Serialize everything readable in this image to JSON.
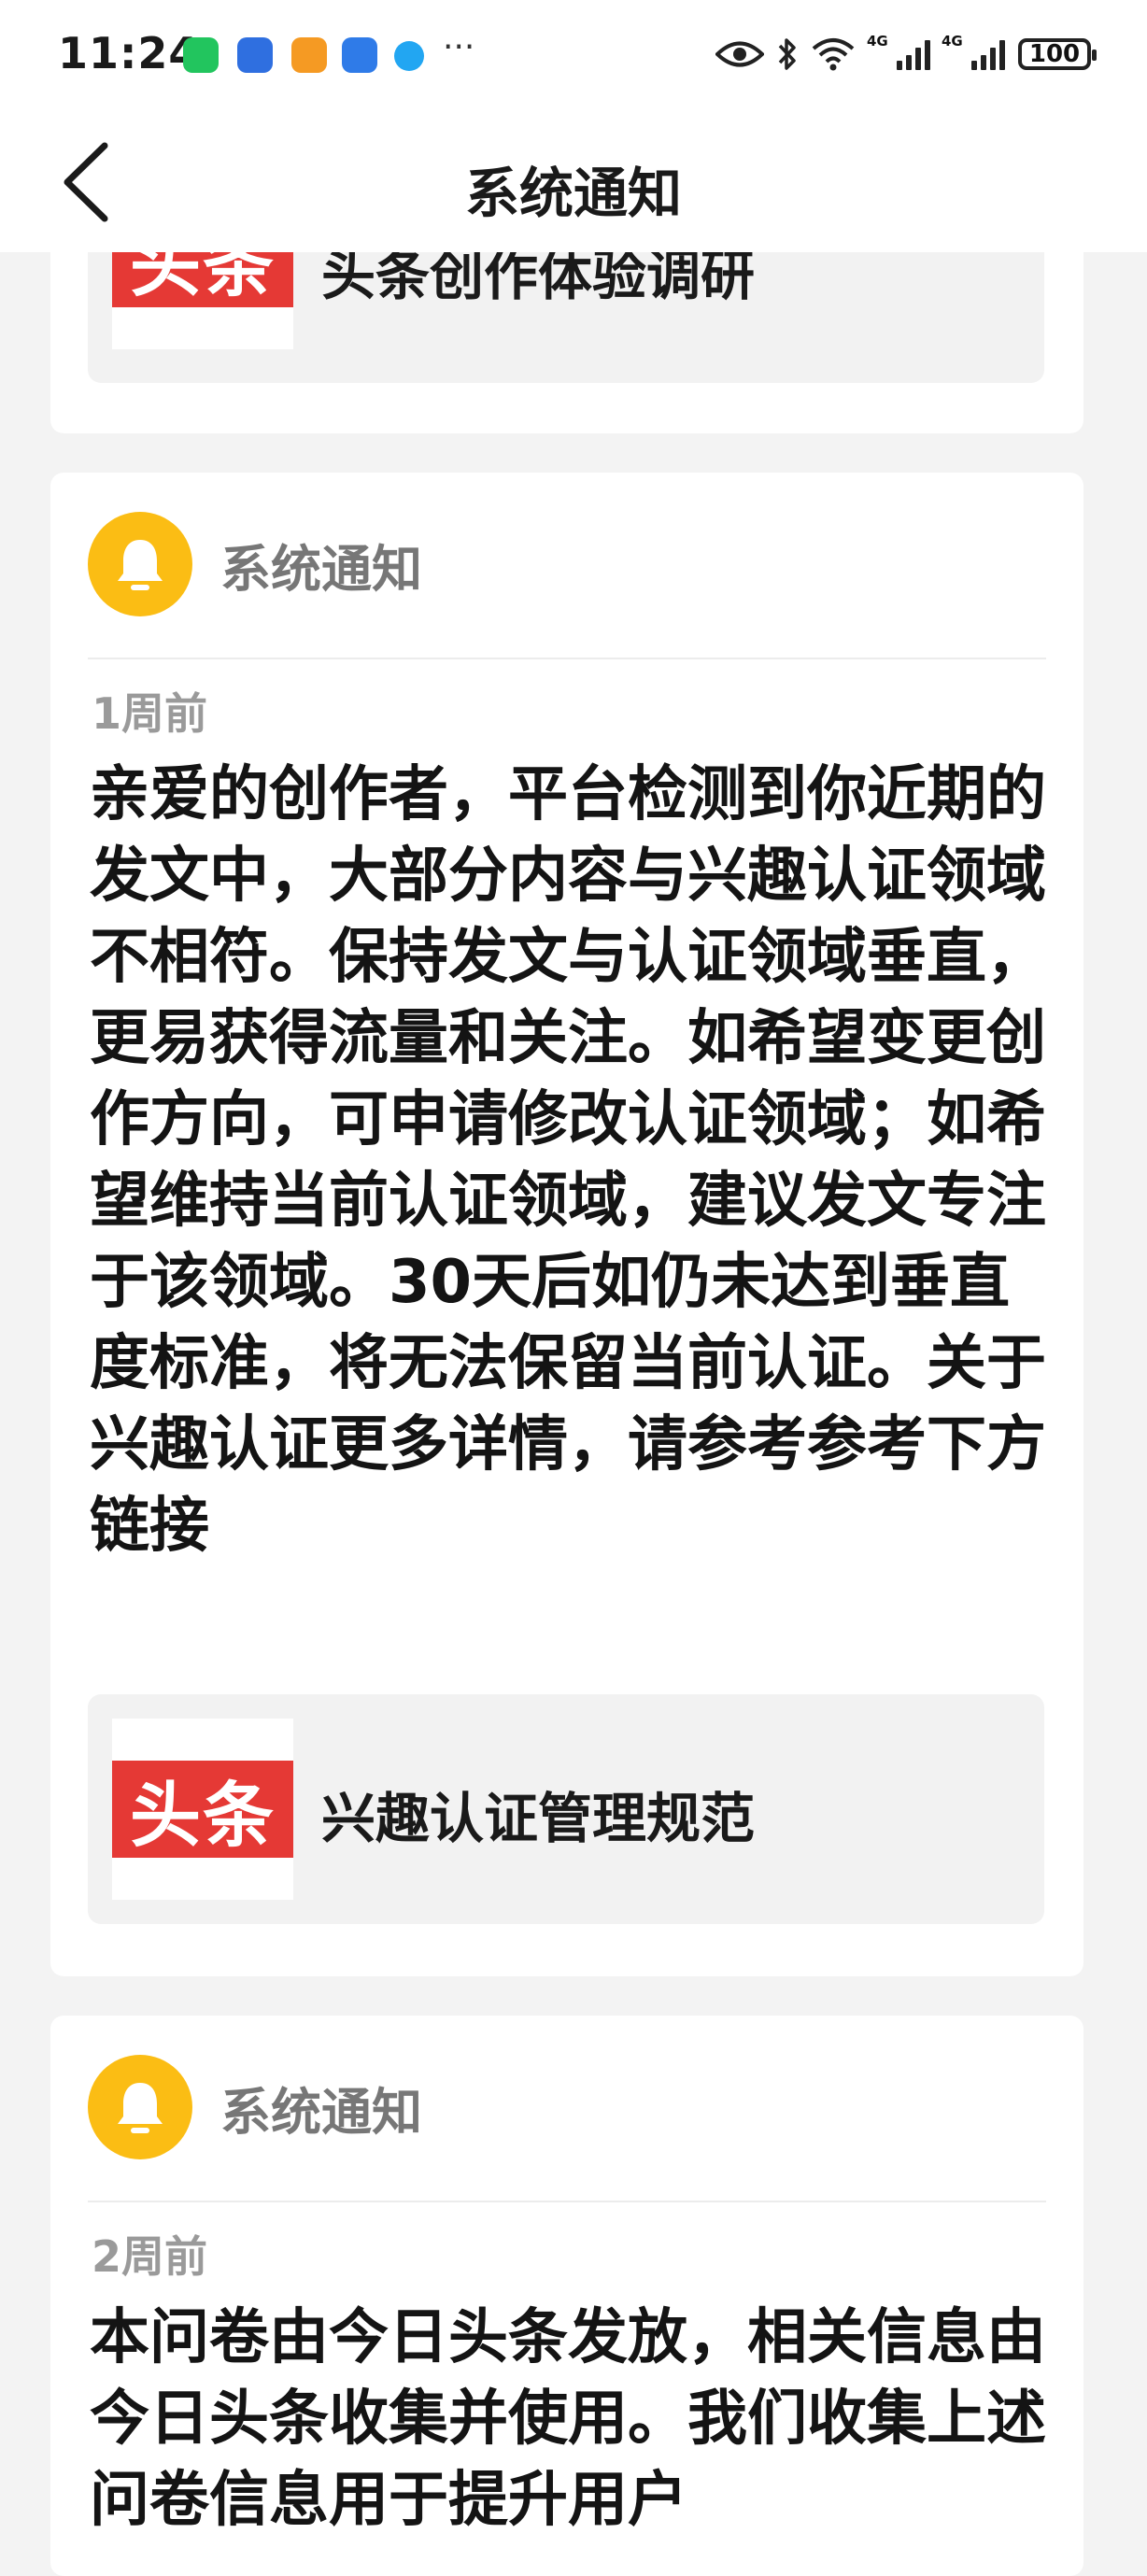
{
  "status_bar": {
    "time": "11:24",
    "app_icons": [
      {
        "name": "wechat-icon",
        "color": "#22c55e"
      },
      {
        "name": "app-blue-icon",
        "color": "#2f6fe0"
      },
      {
        "name": "app-orange-icon",
        "color": "#f59a23"
      },
      {
        "name": "bulb-app-icon",
        "color": "#2f7be8"
      },
      {
        "name": "app-cyan-icon",
        "color": "#22a6f2"
      }
    ],
    "more": "···",
    "network_1": "4G",
    "network_2": "4G",
    "battery": "100"
  },
  "header": {
    "title": "系统通知"
  },
  "messages": [
    {
      "link": {
        "logo_text": "头条",
        "title": "头条创作体验调研"
      }
    },
    {
      "sender": "系统通知",
      "time": "1周前",
      "body": "亲爱的创作者，平台检测到你近期的发文中，大部分内容与兴趣认证领域不相符。保持发文与认证领域垂直，更易获得流量和关注。如希望变更创作方向，可申请修改认证领域；如希望维持当前认证领域，建议发文专注于该领域。30天后如仍未达到垂直度标准，将无法保留当前认证。关于兴趣认证更多详情，请参考参考下方链接",
      "link": {
        "logo_text": "头条",
        "title": "兴趣认证管理规范"
      }
    },
    {
      "sender": "系统通知",
      "time": "2周前",
      "body": "本问卷由今日头条发放，相关信息由今日头条收集并使用。我们收集上述问卷信息用于提升用户"
    }
  ],
  "colors": {
    "accent_bell": "#fbbd14",
    "brand_red": "#e53935",
    "background": "#f3f3f3"
  }
}
